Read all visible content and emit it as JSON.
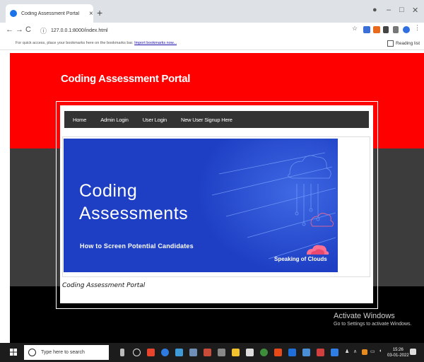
{
  "browser": {
    "tab_title": "Coding Assessment Portal",
    "tab_close": "×",
    "new_tab": "+",
    "url": "127.0.0.1:8000/index.html",
    "bookmarks_hint": "For quick access, place your bookmarks here on the bookmarks bar.",
    "import_bookmarks": "Import bookmarks now...",
    "reading_list": "Reading list"
  },
  "page": {
    "portal_title": "Coding Assessment Portal",
    "nav": [
      {
        "label": "Home"
      },
      {
        "label": "Admin Login"
      },
      {
        "label": "User Login"
      },
      {
        "label": "New User Signup Here"
      }
    ],
    "banner": {
      "line1": "Coding",
      "line2": "Assessments",
      "subtitle": "How to Screen Potential Candidates",
      "brand": "Speaking of Clouds"
    },
    "caption": "Coding Assessment Portal"
  },
  "windows": {
    "activate_title": "Activate Windows",
    "activate_sub": "Go to Settings to activate Windows.",
    "search_placeholder": "Type here to search",
    "time": "15:26",
    "date": "03-01-2022"
  },
  "colors": {
    "header_red": "#ff0000",
    "band_gray": "#3c3c3c",
    "navbar": "#333333",
    "banner_blue": "#1e3fc4"
  }
}
